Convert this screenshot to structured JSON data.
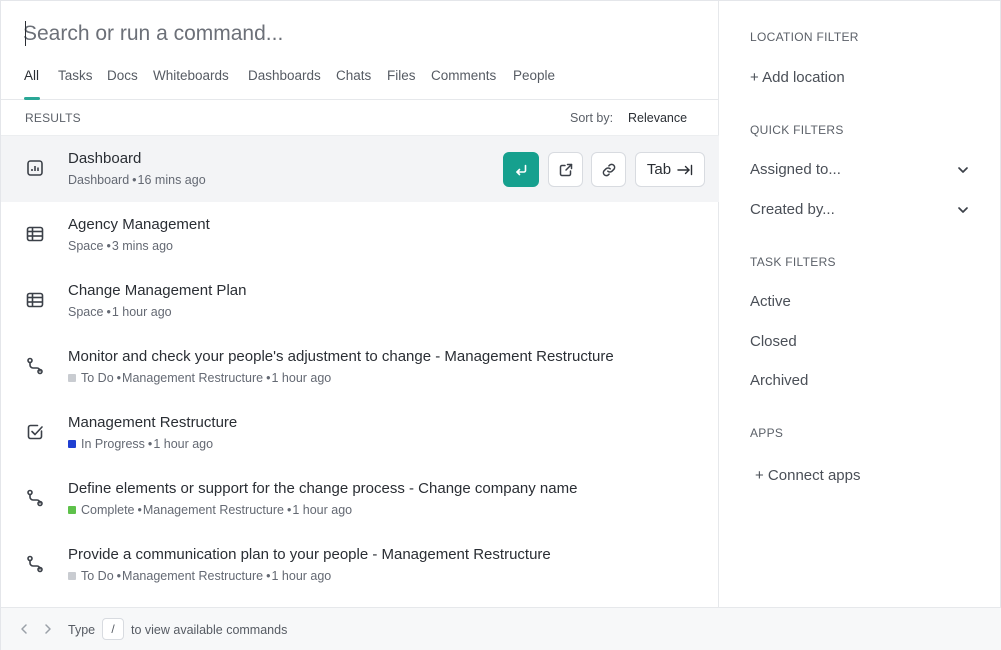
{
  "search": {
    "placeholder": "Search or run a command..."
  },
  "tabs": [
    {
      "label": "All"
    },
    {
      "label": "Tasks"
    },
    {
      "label": "Docs"
    },
    {
      "label": "Whiteboards"
    },
    {
      "label": "Dashboards"
    },
    {
      "label": "Chats"
    },
    {
      "label": "Files"
    },
    {
      "label": "Comments"
    },
    {
      "label": "People"
    }
  ],
  "active_tab": "All",
  "results_header": {
    "label": "RESULTS",
    "sort_label": "Sort by:",
    "sort_value": "Relevance"
  },
  "results": [
    {
      "icon": "dashboard-icon",
      "title": "Dashboard",
      "meta_type": "Dashboard",
      "time": "16 mins ago",
      "selected": true
    },
    {
      "icon": "space-icon",
      "title": "Agency Management",
      "meta_type": "Space",
      "time": "3 mins ago"
    },
    {
      "icon": "space-icon",
      "title": "Change Management Plan",
      "meta_type": "Space",
      "time": "1 hour ago"
    },
    {
      "icon": "route-icon",
      "title": "Monitor and check your people's adjustment to change - Management Restructure",
      "status": "To Do",
      "status_color": "#c9ccd1",
      "location": "Management Restructure",
      "time": "1 hour ago"
    },
    {
      "icon": "checkbox-icon",
      "title": "Management Restructure",
      "status": "In Progress",
      "status_color": "#1f3fd1",
      "time": "1 hour ago"
    },
    {
      "icon": "route-icon",
      "title": "Define elements or support for the change process - Change company name",
      "status": "Complete",
      "status_color": "#5ec14a",
      "location": "Management Restructure",
      "time": "1 hour ago"
    },
    {
      "icon": "route-icon",
      "title": "Provide a communication plan to your people - Management Restructure",
      "status": "To Do",
      "status_color": "#c9ccd1",
      "location": "Management Restructure",
      "time": "1 hour ago"
    }
  ],
  "row_actions": {
    "enter_icon": "enter-icon",
    "open_icon": "open-new-window-icon",
    "link_icon": "link-icon",
    "tab_label": "Tab"
  },
  "meta_separator": "•",
  "sidebar": {
    "location_filter": {
      "heading": "LOCATION FILTER",
      "add_label": "+ Add location"
    },
    "quick_filters": {
      "heading": "QUICK FILTERS",
      "items": [
        "Assigned to...",
        "Created by..."
      ]
    },
    "task_filters": {
      "heading": "TASK FILTERS",
      "items": [
        "Active",
        "Closed",
        "Archived"
      ]
    },
    "apps": {
      "heading": "APPS",
      "connect_label": "+ Connect apps"
    }
  },
  "footer": {
    "type_label": "Type",
    "key": "/",
    "hint": "to view available commands"
  },
  "colors": {
    "accent": "#16a08e",
    "text": "#2a2e34",
    "muted": "#646973"
  }
}
